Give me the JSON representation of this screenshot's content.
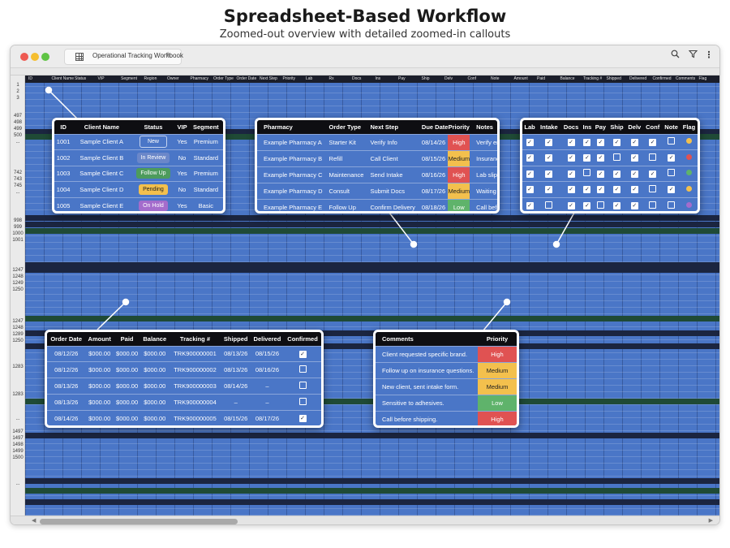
{
  "page": {
    "title": "Spreadsheet-Based Workflow",
    "subtitle": "Zoomed-out overview with detailed zoomed-in callouts"
  },
  "window": {
    "workbook_title": "Operational Tracking Workbook",
    "toolbar_icons": [
      "grid-icon",
      "star-icon",
      "search-icon",
      "filter-icon",
      "more-icon"
    ]
  },
  "sheet": {
    "header_columns": [
      "ID",
      "Client Name",
      "Status",
      "VIP",
      "Segment",
      "Region",
      "Owner",
      "Pharmacy",
      "Order Type",
      "Order Date",
      "Next Step",
      "Priority",
      "Lab",
      "Rx",
      "Docs",
      "Ins",
      "Pay",
      "Ship",
      "Delv",
      "Conf",
      "Note",
      "Amount",
      "Paid",
      "Balance",
      "Tracking #",
      "Shipped",
      "Delivered",
      "Confirmed",
      "Comments",
      "Flag"
    ],
    "row_numbers": [
      "1",
      "2",
      "3",
      "497",
      "498",
      "499",
      "500",
      "...",
      "742",
      "743",
      "745",
      "...",
      "998",
      "999",
      "1000",
      "1001",
      "1247",
      "1248",
      "1249",
      "1250",
      "1247",
      "1248",
      "1289",
      "1250",
      "1283",
      "1283",
      "...",
      "1497",
      "1497",
      "1498",
      "1499",
      "1500",
      "..."
    ]
  },
  "callout_clients": {
    "headers": [
      "ID",
      "Client Name",
      "Status",
      "VIP",
      "Segment"
    ],
    "rows": [
      {
        "id": "1001",
        "name": "Sample Client A",
        "status": "New",
        "vip": "Yes",
        "segment": "Premium"
      },
      {
        "id": "1002",
        "name": "Sample Client B",
        "status": "In Review",
        "vip": "No",
        "segment": "Standard"
      },
      {
        "id": "1003",
        "name": "Sample Client C",
        "status": "Follow Up",
        "vip": "Yes",
        "segment": "Premium"
      },
      {
        "id": "1004",
        "name": "Sample Client D",
        "status": "Pending",
        "vip": "No",
        "segment": "Standard"
      },
      {
        "id": "1005",
        "name": "Sample Client E",
        "status": "On Hold",
        "vip": "Yes",
        "segment": "Basic"
      }
    ]
  },
  "callout_pharmacy": {
    "headers": [
      "Pharmacy",
      "Order Type",
      "Next Step",
      "Due Date",
      "Priority",
      "Notes"
    ],
    "rows": [
      {
        "pharmacy": "Example Pharmacy A",
        "order_type": "Starter Kit",
        "next_step": "Verify Info",
        "due": "08/14/26",
        "priority": "High",
        "notes": "Verify email"
      },
      {
        "pharmacy": "Example Pharmacy B",
        "order_type": "Refill",
        "next_step": "Call Client",
        "due": "08/15/26",
        "priority": "Medium",
        "notes": "Insurance pending"
      },
      {
        "pharmacy": "Example Pharmacy C",
        "order_type": "Maintenance",
        "next_step": "Send Intake",
        "due": "08/16/26",
        "priority": "High",
        "notes": "Lab slip missing"
      },
      {
        "pharmacy": "Example Pharmacy D",
        "order_type": "Consult",
        "next_step": "Submit Docs",
        "due": "08/17/26",
        "priority": "Medium",
        "notes": "Waiting on client"
      },
      {
        "pharmacy": "Example Pharmacy E",
        "order_type": "Follow Up",
        "next_step": "Confirm Delivery",
        "due": "08/18/26",
        "priority": "Low",
        "notes": "Call before shipping"
      }
    ]
  },
  "callout_checklist": {
    "headers": [
      "Lab",
      "Intake",
      "Docs",
      "Ins",
      "Pay",
      "Ship",
      "Delv",
      "Conf",
      "Note",
      "Flag"
    ],
    "rows": [
      {
        "checks": [
          true,
          true,
          true,
          true,
          true,
          true,
          true,
          true,
          false
        ],
        "flag_color": "#f3c04d"
      },
      {
        "checks": [
          true,
          true,
          true,
          true,
          true,
          false,
          true,
          false,
          true
        ],
        "flag_color": "#e05252"
      },
      {
        "checks": [
          true,
          true,
          true,
          false,
          true,
          true,
          true,
          true,
          false
        ],
        "flag_color": "#5fb36b"
      },
      {
        "checks": [
          true,
          true,
          true,
          true,
          true,
          true,
          true,
          false,
          true
        ],
        "flag_color": "#f3c04d"
      },
      {
        "checks": [
          true,
          false,
          true,
          true,
          false,
          true,
          true,
          false,
          false
        ],
        "flag_color": "#a46ccc"
      }
    ]
  },
  "callout_orders": {
    "headers": [
      "Order Date",
      "Amount",
      "Paid",
      "Balance",
      "Tracking #",
      "Shipped",
      "Delivered",
      "Confirmed"
    ],
    "rows": [
      {
        "date": "08/12/26",
        "amount": "$000.00",
        "paid": "$000.00",
        "balance": "$000.00",
        "tracking": "TRK900000001",
        "shipped": "08/13/26",
        "delivered": "08/15/26",
        "confirmed": true
      },
      {
        "date": "08/12/26",
        "amount": "$000.00",
        "paid": "$000.00",
        "balance": "$000.00",
        "tracking": "TRK900000002",
        "shipped": "08/13/26",
        "delivered": "08/16/26",
        "confirmed": false
      },
      {
        "date": "08/13/26",
        "amount": "$000.00",
        "paid": "$000.00",
        "balance": "$000.00",
        "tracking": "TRK900000003",
        "shipped": "08/14/26",
        "delivered": "–",
        "confirmed": false
      },
      {
        "date": "08/13/26",
        "amount": "$000.00",
        "paid": "$000.00",
        "balance": "$000.00",
        "tracking": "TRK900000004",
        "shipped": "–",
        "delivered": "–",
        "confirmed": false
      },
      {
        "date": "08/14/26",
        "amount": "$000.00",
        "paid": "$000.00",
        "balance": "$000.00",
        "tracking": "TRK900000005",
        "shipped": "08/15/26",
        "delivered": "08/17/26",
        "confirmed": true
      }
    ]
  },
  "callout_comments": {
    "headers": [
      "Comments",
      "Priority"
    ],
    "rows": [
      {
        "comment": "Client requested specific brand.",
        "priority": "High"
      },
      {
        "comment": "Follow up on insurance questions.",
        "priority": "Medium"
      },
      {
        "comment": "New client, sent intake form.",
        "priority": "Medium"
      },
      {
        "comment": "Sensitive to adhesives.",
        "priority": "Low"
      },
      {
        "comment": "Call before shipping.",
        "priority": "High"
      }
    ]
  },
  "colors": {
    "sheet_blue": "#4a76c7",
    "header_black": "#0e0e12",
    "high": "#e05252",
    "medium": "#f3c04d",
    "low": "#5fb36b",
    "on_hold": "#a46ccc",
    "follow_up": "#4d9b5c"
  }
}
